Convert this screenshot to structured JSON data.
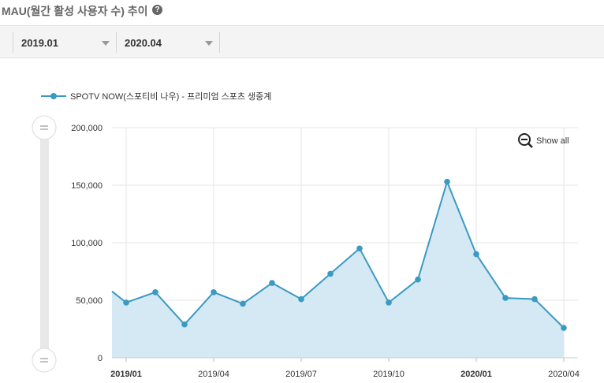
{
  "header": {
    "title": "MAU(월간 활성 사용자 수) 추이",
    "help_icon": "question-circle-icon"
  },
  "filters": {
    "start_value": "2019.01",
    "end_value": "2020.04"
  },
  "chart_controls": {
    "reset_zoom_label": "Show all",
    "zoom_icon": "zoom-out-icon"
  },
  "colors": {
    "line": "#3a9ac2",
    "area": "#d4e9f3",
    "grid": "#e6e6e6"
  },
  "chart_data": {
    "type": "area",
    "title": "",
    "xlabel": "",
    "ylabel": "",
    "ylim": [
      0,
      200000
    ],
    "yticks": [
      0,
      50000,
      100000,
      150000,
      200000
    ],
    "ytick_labels": [
      "0",
      "50,000",
      "100,000",
      "150,000",
      "200,000"
    ],
    "xticks": [
      "2019/01",
      "2019/04",
      "2019/07",
      "2019/10",
      "2020/01",
      "2020/04"
    ],
    "categories": [
      "2018/12",
      "2019/01",
      "2019/02",
      "2019/03",
      "2019/04",
      "2019/05",
      "2019/06",
      "2019/07",
      "2019/08",
      "2019/09",
      "2019/10",
      "2019/11",
      "2019/12",
      "2020/01",
      "2020/02",
      "2020/03",
      "2020/04"
    ],
    "legend": "top-left",
    "series": [
      {
        "name": "SPOTV NOW(스포티비 나우) - 프리미엄 스포츠 생중계",
        "values": [
          68000,
          48000,
          57000,
          29000,
          57000,
          47000,
          65000,
          51000,
          73000,
          95000,
          48000,
          68000,
          153000,
          90000,
          52000,
          51000,
          26000
        ]
      }
    ]
  }
}
